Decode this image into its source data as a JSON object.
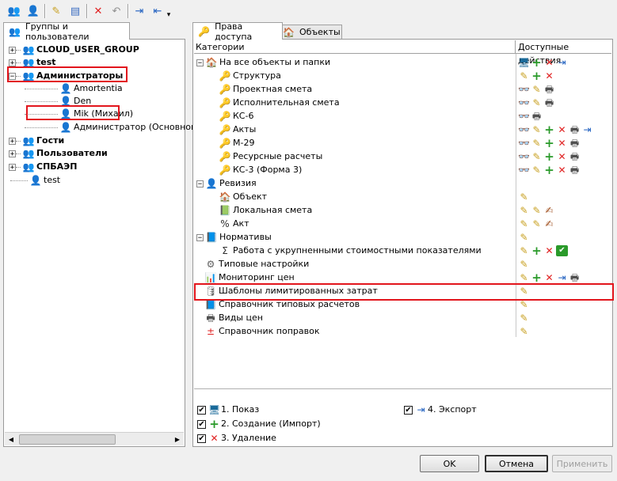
{
  "toolbar": {
    "buttons": [
      {
        "name": "add-group-icon",
        "glyph": "👥"
      },
      {
        "name": "add-user-icon",
        "glyph": "👤"
      },
      {
        "name": "edit-icon",
        "glyph": "✎"
      },
      {
        "name": "properties-icon",
        "glyph": "▤"
      },
      {
        "name": "delete-icon",
        "glyph": "✕"
      },
      {
        "name": "undo-icon",
        "glyph": "↶"
      },
      {
        "name": "export-icon",
        "glyph": "⇥"
      },
      {
        "name": "import-icon",
        "glyph": "⇤"
      },
      {
        "name": "dropdown-icon",
        "glyph": "▾"
      }
    ]
  },
  "left": {
    "tab_label": "Группы и пользователи",
    "tree": [
      {
        "label": "CLOUD_USER_GROUP",
        "bold": true,
        "kind": "group"
      },
      {
        "label": "test",
        "bold": true,
        "kind": "group"
      },
      {
        "label": "Администраторы",
        "bold": true,
        "kind": "group"
      },
      {
        "label": "Amortentia",
        "bold": false,
        "kind": "user"
      },
      {
        "label": "Den",
        "bold": false,
        "kind": "user"
      },
      {
        "label": "Mik (Михаил)",
        "bold": false,
        "kind": "user"
      },
      {
        "label": "Администратор (Основной адми",
        "bold": false,
        "kind": "user"
      },
      {
        "label": "Гости",
        "bold": true,
        "kind": "group"
      },
      {
        "label": "Пользователи",
        "bold": true,
        "kind": "group"
      },
      {
        "label": "СПБАЭП",
        "bold": true,
        "kind": "group"
      },
      {
        "label": "test",
        "bold": false,
        "kind": "user"
      }
    ]
  },
  "right": {
    "tabs": [
      {
        "label": "Права доступа",
        "icon": "key-icon"
      },
      {
        "label": "Объекты",
        "icon": "house-icon"
      }
    ],
    "columns": {
      "categories": "Категории",
      "actions": "Доступные действия"
    },
    "rows": [
      {
        "label": "На все объекты и папки",
        "icon": "🏠",
        "actions": [
          "🖥",
          "+",
          "✕",
          "⇥"
        ]
      },
      {
        "label": "Структура",
        "icon": "🔑",
        "actions": [
          "✎",
          "+",
          "✕"
        ]
      },
      {
        "label": "Проектная смета",
        "icon": "🔑",
        "actions": [
          "👓",
          "✎",
          "🖶"
        ]
      },
      {
        "label": "Исполнительная смета",
        "icon": "🔑",
        "actions": [
          "👓",
          "✎",
          "🖶"
        ]
      },
      {
        "label": "КС-6",
        "icon": "🔑",
        "actions": [
          "👓",
          "🖶"
        ]
      },
      {
        "label": "Акты",
        "icon": "🔑",
        "actions": [
          "👓",
          "✎",
          "+",
          "✕",
          "🖶",
          "⇥"
        ]
      },
      {
        "label": "М-29",
        "icon": "🔑",
        "actions": [
          "👓",
          "✎",
          "+",
          "✕",
          "🖶"
        ]
      },
      {
        "label": "Ресурсные расчеты",
        "icon": "🔑",
        "actions": [
          "👓",
          "✎",
          "+",
          "✕",
          "🖶"
        ]
      },
      {
        "label": "КС-3 (Форма 3)",
        "icon": "🔑",
        "actions": [
          "👓",
          "✎",
          "+",
          "✕",
          "🖶"
        ]
      },
      {
        "label": "Ревизия",
        "icon": "👤",
        "actions": []
      },
      {
        "label": "Объект",
        "icon": "🏠",
        "actions": [
          "✎"
        ]
      },
      {
        "label": "Локальная смета",
        "icon": "📗",
        "actions": [
          "✎",
          "✎",
          "✍"
        ]
      },
      {
        "label": "Акт",
        "icon": "%",
        "actions": [
          "✎",
          "✎",
          "✍"
        ]
      },
      {
        "label": "Нормативы",
        "icon": "📘",
        "actions": [
          "✎"
        ]
      },
      {
        "label": "Работа с укрупненными стоимостными показателями",
        "icon": "Σ",
        "actions": [
          "✎",
          "+",
          "✕",
          "✔"
        ]
      },
      {
        "label": "Типовые настройки",
        "icon": "⚙",
        "actions": [
          "✎"
        ]
      },
      {
        "label": "Мониторинг цен",
        "icon": "📊",
        "actions": [
          "✎",
          "+",
          "✕",
          "⇥",
          "🖶"
        ]
      },
      {
        "label": "Шаблоны лимитированных затрат",
        "icon": "🛢",
        "actions": [
          "✎"
        ]
      },
      {
        "label": "Справочник типовых расчетов",
        "icon": "📘",
        "actions": [
          "✎"
        ]
      },
      {
        "label": "Виды цен",
        "icon": "🖶",
        "actions": [
          "✎"
        ]
      },
      {
        "label": "Справочник поправок",
        "icon": "±",
        "actions": [
          "✎"
        ]
      }
    ],
    "legend": [
      {
        "label": "1. Показ",
        "icon": "🖥"
      },
      {
        "label": "2. Создание (Импорт)",
        "icon": "+"
      },
      {
        "label": "3. Удаление",
        "icon": "✕"
      },
      {
        "label": "4. Экспорт",
        "icon": "⇥"
      }
    ]
  },
  "buttons": {
    "ok": "OK",
    "cancel": "Отмена",
    "apply": "Применить"
  }
}
